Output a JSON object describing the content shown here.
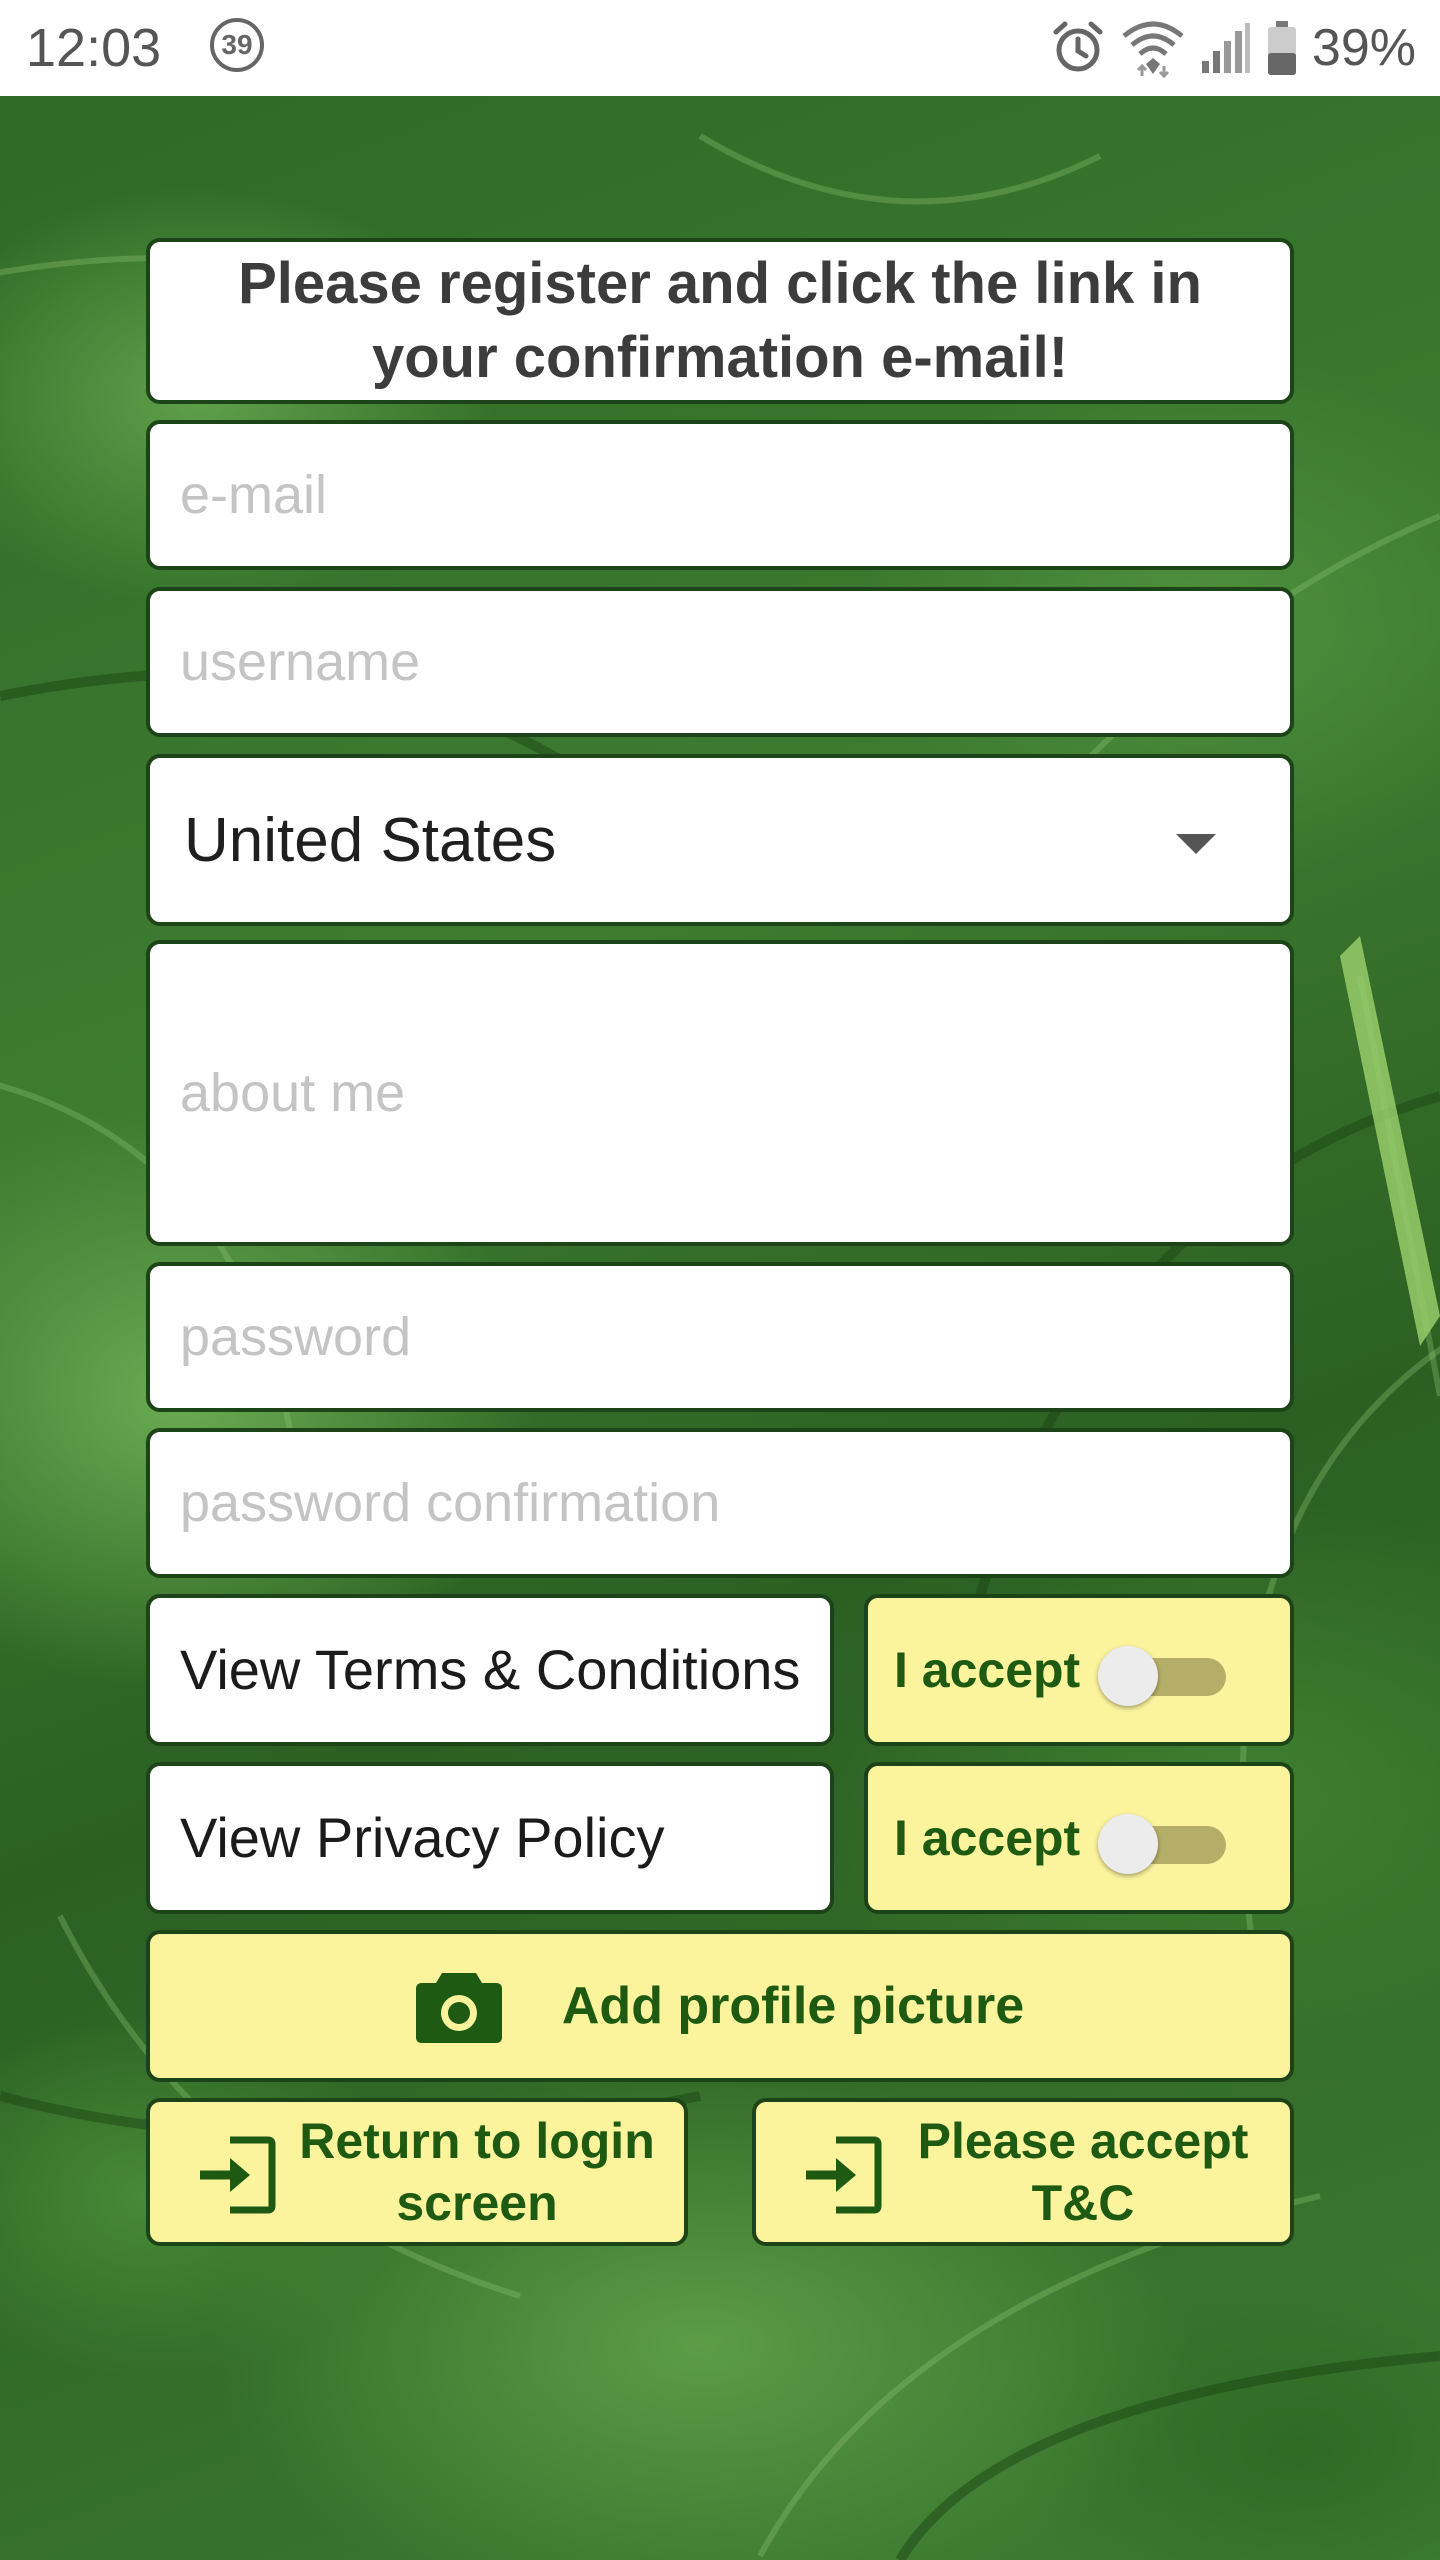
{
  "status_bar": {
    "time": "12:03",
    "notification_count": "39",
    "battery": "39%"
  },
  "header": {
    "message": "Please register and click the link in your confirmation e-mail!"
  },
  "form": {
    "email_placeholder": "e-mail",
    "username_placeholder": "username",
    "country_selected": "United States",
    "about_placeholder": "about me",
    "password_placeholder": "password",
    "password_confirm_placeholder": "password confirmation",
    "terms_link": "View Terms & Conditions",
    "privacy_link": "View Privacy Policy",
    "terms_accept_label": "I accept",
    "terms_accept_on": false,
    "privacy_accept_label": "I accept",
    "privacy_accept_on": false,
    "add_picture_label": "Add profile picture",
    "return_label": "Return to login screen",
    "accept_tc_label": "Please accept T&C"
  },
  "colors": {
    "border": "#1d4418",
    "button_bg": "#fbf49d",
    "button_text": "#1e5a12",
    "placeholder": "#c4c4c4"
  },
  "icons": {
    "camera": "camera-icon",
    "login": "login-icon",
    "alarm": "alarm-icon",
    "wifi": "wifi-icon",
    "signal": "signal-icon",
    "battery": "battery-icon"
  }
}
